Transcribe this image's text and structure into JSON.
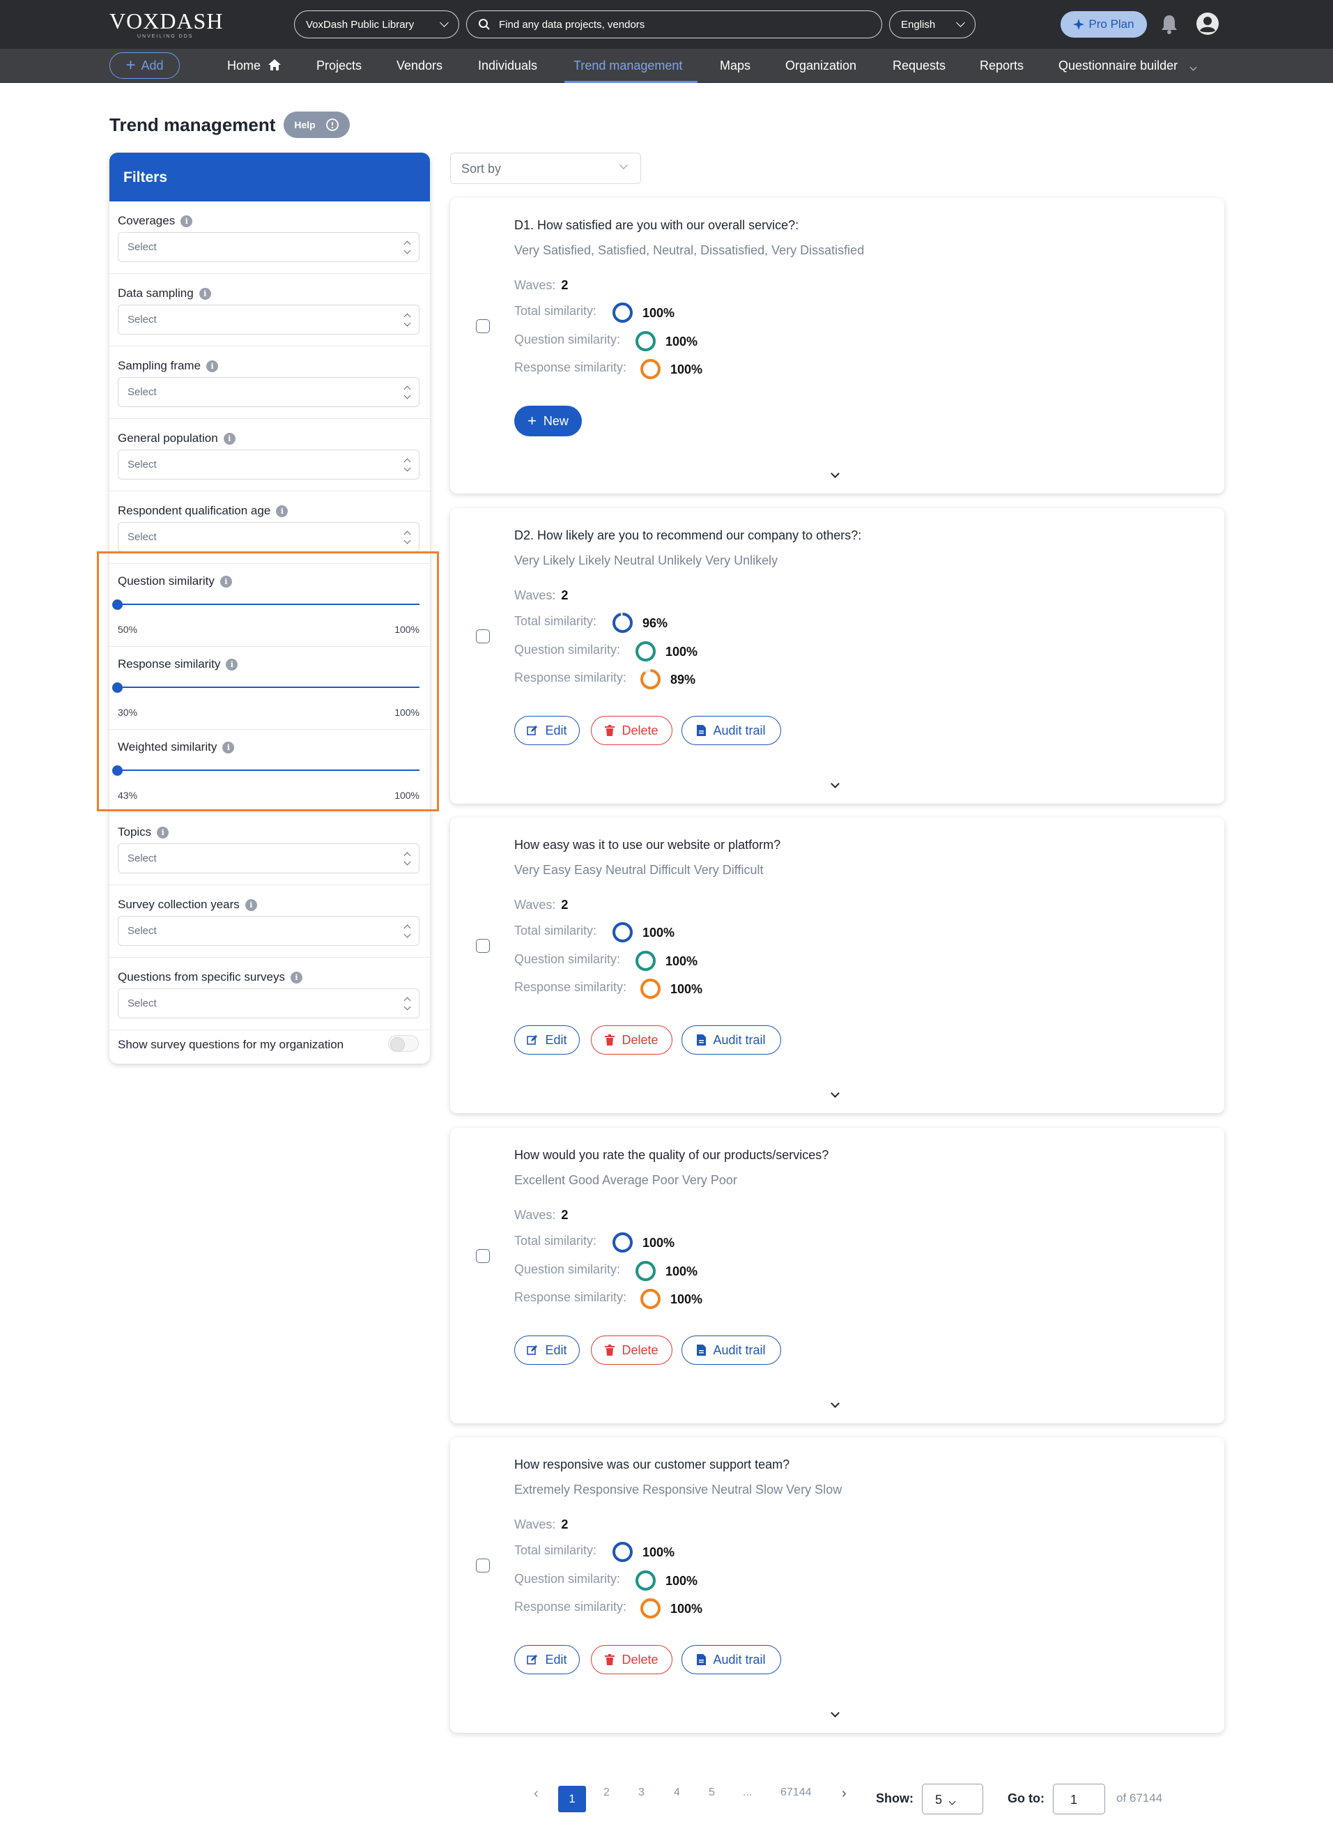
{
  "header": {
    "logo": "VOXDASH",
    "logo_tagline": "UNVEILING DDS",
    "library_selector": "VoxDash Public Library",
    "search_placeholder": "Find any data projects, vendors",
    "language": "English",
    "pro_plan": "Pro Plan"
  },
  "nav": {
    "add_label": "Add",
    "items": [
      "Home",
      "Projects",
      "Vendors",
      "Individuals",
      "Trend management",
      "Maps",
      "Organization",
      "Requests",
      "Reports",
      "Questionnaire builder"
    ],
    "active": "Trend management"
  },
  "page": {
    "title": "Trend management",
    "help_label": "Help",
    "sort_placeholder": "Sort by"
  },
  "filters": {
    "title": "Filters",
    "select_placeholder": "Select",
    "selects": [
      "Coverages",
      "Data sampling",
      "Sampling frame",
      "General population",
      "Respondent qualification age"
    ],
    "sliders": [
      {
        "label": "Question similarity",
        "min": "50%",
        "max": "100%"
      },
      {
        "label": "Response similarity",
        "min": "30%",
        "max": "100%"
      },
      {
        "label": "Weighted similarity",
        "min": "43%",
        "max": "100%"
      }
    ],
    "selects_after": [
      "Topics",
      "Survey collection years",
      "Questions from specific surveys"
    ],
    "toggle_label": "Show survey questions for my organization"
  },
  "metric_labels": {
    "waves": "Waves:",
    "total": "Total similarity:",
    "question": "Question similarity:",
    "response": "Response similarity:"
  },
  "buttons": {
    "new": "New",
    "edit": "Edit",
    "delete": "Delete",
    "audit": "Audit trail"
  },
  "ring_colors": {
    "total": "#1e56b7",
    "question": "#1f9384",
    "response": "#f0831e"
  },
  "results": [
    {
      "question": "D1. How satisfied are you with our overall service?:",
      "responses": "Very Satisfied, Satisfied, Neutral, Dissatisfied, Very Dissatisfied",
      "waves": "2",
      "total": "100%",
      "question_sim": "100%",
      "response_sim": "100%",
      "actions": "new"
    },
    {
      "question": "D2. How likely are you to recommend our company to others?:",
      "responses": "Very Likely Likely Neutral Unlikely Very Unlikely",
      "waves": "2",
      "total": "96%",
      "question_sim": "100%",
      "response_sim": "89%",
      "actions": "edit"
    },
    {
      "question": "How easy was it to use our website or platform?",
      "responses": "Very Easy Easy Neutral Difficult Very Difficult",
      "waves": "2",
      "total": "100%",
      "question_sim": "100%",
      "response_sim": "100%",
      "actions": "edit"
    },
    {
      "question": "How would you rate the quality of our products/services?",
      "responses": "Excellent Good Average Poor Very Poor",
      "waves": "2",
      "total": "100%",
      "question_sim": "100%",
      "response_sim": "100%",
      "actions": "edit"
    },
    {
      "question": "How responsive was our customer support team?",
      "responses": "Extremely Responsive Responsive Neutral Slow Very Slow",
      "waves": "2",
      "total": "100%",
      "question_sim": "100%",
      "response_sim": "100%",
      "actions": "edit"
    }
  ],
  "pagination": {
    "pages": [
      "1",
      "2",
      "3",
      "4",
      "5",
      "...",
      "67144"
    ],
    "current": "1",
    "show_label": "Show:",
    "show_value": "5",
    "goto_label": "Go to:",
    "goto_value": "1",
    "of_total": "of 67144"
  }
}
